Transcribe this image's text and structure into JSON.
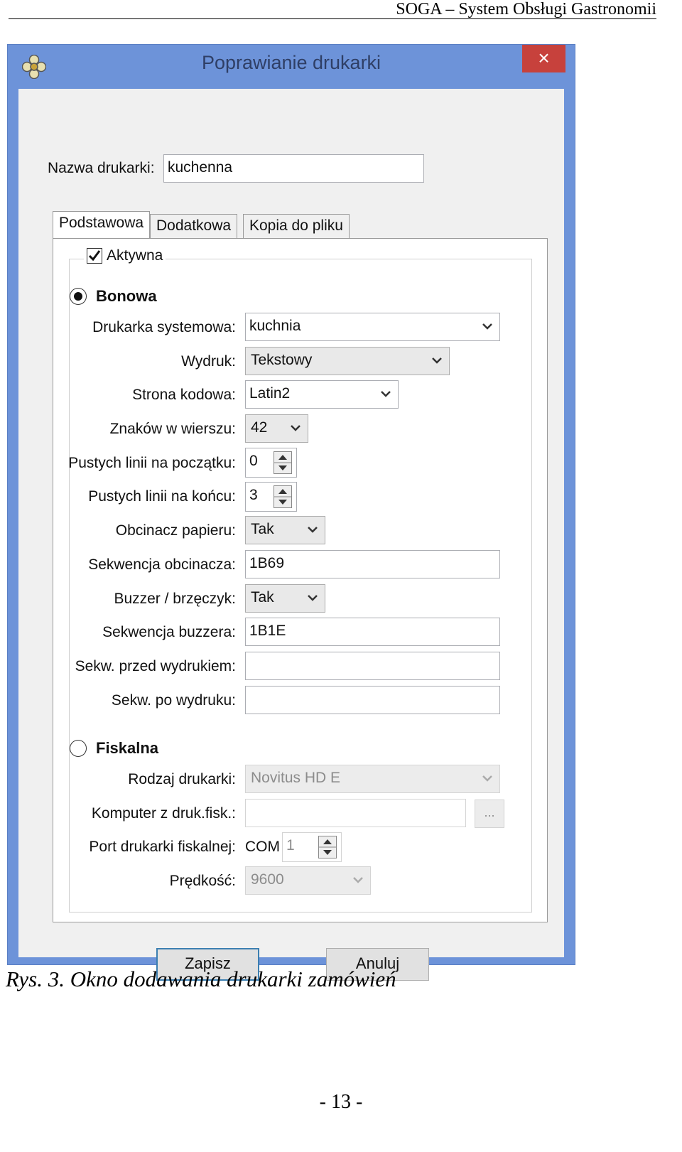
{
  "document": {
    "header": "SOGA – System Obsługi Gastronomii",
    "caption": "Rys. 3. Okno dodawania drukarki zamówień",
    "page_number": "- 13 -"
  },
  "window": {
    "title": "Poprawianie drukarki",
    "close_label": "×",
    "printer_name_label": "Nazwa drukarki:",
    "printer_name_value": "kuchenna",
    "tabs": [
      {
        "label": "Podstawowa",
        "active": true
      },
      {
        "label": "Dodatkowa",
        "active": false
      },
      {
        "label": "Kopia do pliku",
        "active": false
      }
    ],
    "active_checkbox": {
      "label": "Aktywna",
      "checked": true
    },
    "receipt": {
      "radio_label": "Bonowa",
      "selected": true,
      "system_printer": {
        "label": "Drukarka systemowa:",
        "value": "kuchnia"
      },
      "printout": {
        "label": "Wydruk:",
        "value": "Tekstowy"
      },
      "code_page": {
        "label": "Strona kodowa:",
        "value": "Latin2"
      },
      "chars_per_line": {
        "label": "Znaków w wierszu:",
        "value": "42"
      },
      "blank_lines_start": {
        "label": "Pustych linii na początku:",
        "value": "0"
      },
      "blank_lines_end": {
        "label": "Pustych linii na końcu:",
        "value": "3"
      },
      "paper_cutter": {
        "label": "Obcinacz papieru:",
        "value": "Tak"
      },
      "cutter_sequence": {
        "label": "Sekwencja obcinacza:",
        "value": "1B69"
      },
      "buzzer": {
        "label": "Buzzer / brzęczyk:",
        "value": "Tak"
      },
      "buzzer_sequence": {
        "label": "Sekwencja buzzera:",
        "value": "1B1E"
      },
      "seq_before": {
        "label": "Sekw. przed wydrukiem:",
        "value": ""
      },
      "seq_after": {
        "label": "Sekw. po wydruku:",
        "value": ""
      }
    },
    "fiscal": {
      "radio_label": "Fiskalna",
      "selected": false,
      "printer_type": {
        "label": "Rodzaj drukarki:",
        "value": "Novitus HD E"
      },
      "computer": {
        "label": "Komputer z druk.fisk.:",
        "value": "",
        "browse_label": "..."
      },
      "port": {
        "label": "Port drukarki fiskalnej:",
        "prefix": "COM",
        "value": "1"
      },
      "speed": {
        "label": "Prędkość:",
        "value": "9600"
      }
    },
    "buttons": {
      "save": "Zapisz",
      "cancel": "Anuluj"
    }
  },
  "colors": {
    "title_bar": "#6d93d9",
    "close_button": "#c7413c",
    "dialog_bg": "#f0f0f0",
    "default_button_border": "#3c7fb1"
  }
}
